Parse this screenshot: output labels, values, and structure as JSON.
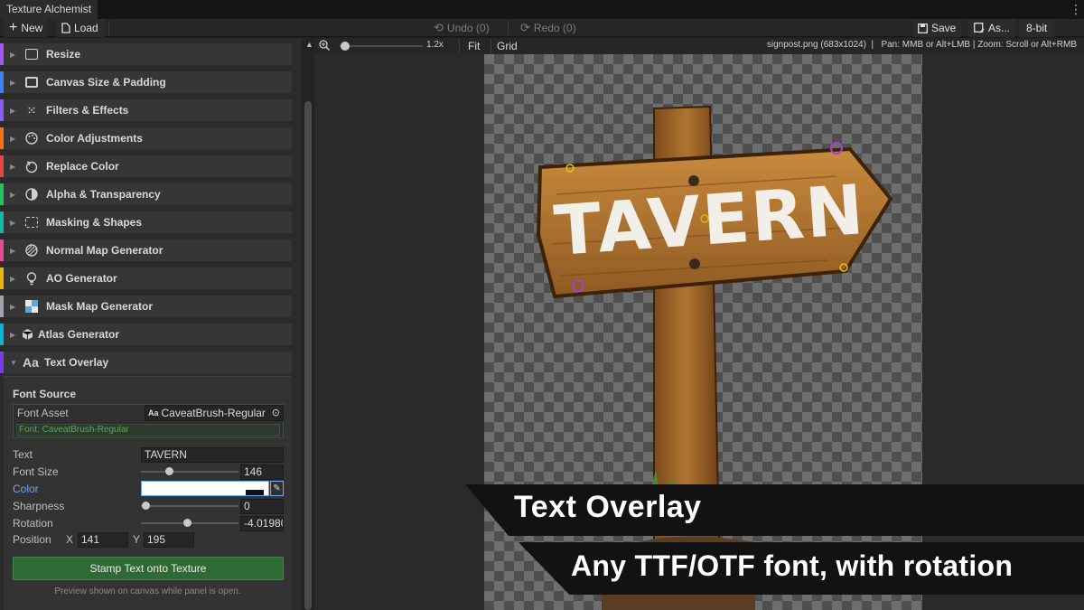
{
  "window": {
    "title": "Texture Alchemist",
    "menu_icon": "kebab-icon"
  },
  "toolbar": {
    "new": "New",
    "load": "Load",
    "undo": "Undo (0)",
    "redo": "Redo (0)",
    "save": "Save",
    "save_as": "As...",
    "bit_depth": "8-bit"
  },
  "sidebar": {
    "sections": [
      {
        "label": "Resize",
        "color": "#a855f7",
        "icon": "resize-icon"
      },
      {
        "label": "Canvas Size & Padding",
        "color": "#3b82f6",
        "icon": "canvas-size-icon"
      },
      {
        "label": "Filters & Effects",
        "color": "#8b5cf6",
        "icon": "filter-icon"
      },
      {
        "label": "Color Adjustments",
        "color": "#f97316",
        "icon": "palette-icon"
      },
      {
        "label": "Replace Color",
        "color": "#ef4444",
        "icon": "replace-color-icon"
      },
      {
        "label": "Alpha & Transparency",
        "color": "#22c55e",
        "icon": "alpha-icon"
      },
      {
        "label": "Masking & Shapes",
        "color": "#14b8a6",
        "icon": "mask-shapes-icon"
      },
      {
        "label": "Normal Map Generator",
        "color": "#ec4899",
        "icon": "normal-map-icon"
      },
      {
        "label": "AO Generator",
        "color": "#eab308",
        "icon": "lightbulb-icon"
      },
      {
        "label": "Mask Map Generator",
        "color": "#9ca3af",
        "icon": "mask-map-icon"
      },
      {
        "label": "Atlas Generator",
        "color": "#06b6d4",
        "icon": "cube-icon"
      },
      {
        "label": "Text Overlay",
        "color": "#7c3aed",
        "icon": "text-icon",
        "icon_text": "Aa"
      }
    ],
    "text_overlay": {
      "font_source_heading": "Font Source",
      "font_asset_label": "Font Asset",
      "font_asset_value": "CaveatBrush-Regular",
      "font_asset_prefix": "Aa",
      "font_status": "Font: CaveatBrush-Regular",
      "text_label": "Text",
      "text_value": "TAVERN",
      "font_size_label": "Font Size",
      "font_size_value": "146",
      "font_size_fraction": 0.25,
      "color_label": "Color",
      "color_value": "#ffffff",
      "sharpness_label": "Sharpness",
      "sharpness_value": "0",
      "sharpness_fraction": 0.0,
      "rotation_label": "Rotation",
      "rotation_value": "-4.01980",
      "rotation_fraction": 0.46,
      "position_label": "Position",
      "pos_x_label": "X",
      "pos_x_value": "141",
      "pos_y_label": "Y",
      "pos_y_value": "195",
      "stamp_button": "Stamp Text onto Texture",
      "preview_note": "Preview shown on canvas while panel is open."
    }
  },
  "canvas": {
    "zoom_label": "1.2x",
    "zoom_fraction": 0.08,
    "fit": "Fit",
    "grid": "Grid",
    "status": "signpost.png (683x1024)  |   Pan: MMB or Alt+LMB | Zoom: Scroll or Alt+RMB",
    "sign_text": "TAVERN"
  },
  "overlay": {
    "headline": "Text Overlay",
    "subline": "Any TTF/OTF font, with rotation"
  }
}
